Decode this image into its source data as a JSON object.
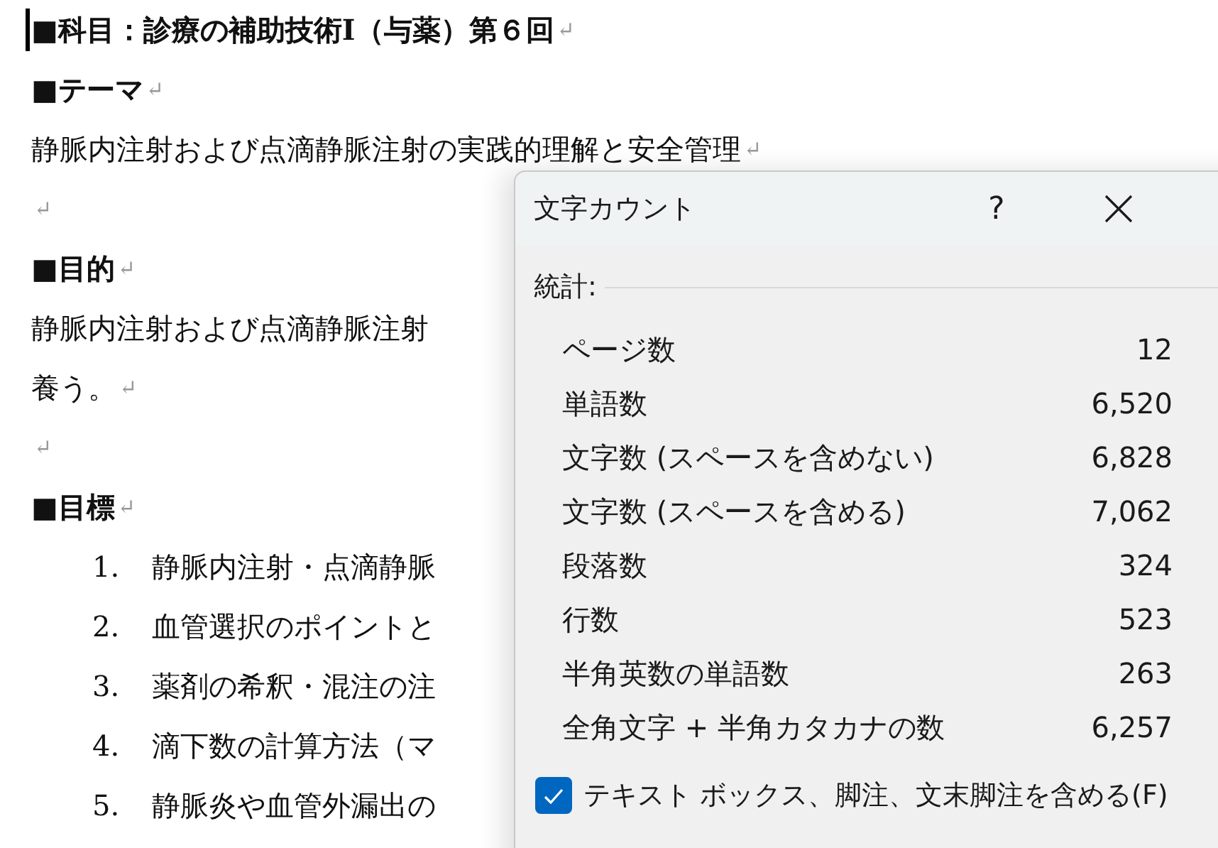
{
  "document": {
    "paragraphs": [
      {
        "kind": "heading",
        "text": "■科目：診療の補助技術Ⅰ（与薬）第６回",
        "mark": "↵",
        "cursor": true
      },
      {
        "kind": "heading",
        "text": "■テーマ",
        "mark": "↵"
      },
      {
        "kind": "body",
        "text": "静脈内注射および点滴静脈注射の実践的理解と安全管理",
        "mark": "↵"
      },
      {
        "kind": "empty",
        "mark": "↵"
      },
      {
        "kind": "heading",
        "text": "■目的",
        "mark": "↵"
      },
      {
        "kind": "body",
        "text": "静脈内注射および点滴静脈注射"
      },
      {
        "kind": "body",
        "text": "養う。",
        "mark": "↵"
      },
      {
        "kind": "empty",
        "mark": "↵"
      },
      {
        "kind": "heading",
        "text": "■目標",
        "mark": "↵"
      },
      {
        "kind": "list",
        "number": "1.",
        "text": "静脈内注射・点滴静脈"
      },
      {
        "kind": "list",
        "number": "2.",
        "text": "血管選択のポイントと"
      },
      {
        "kind": "list",
        "number": "3.",
        "text": "薬剤の希釈・混注の注"
      },
      {
        "kind": "list",
        "number": "4.",
        "text": "滴下数の計算方法（マ"
      },
      {
        "kind": "list",
        "number": "5.",
        "text": "静脈炎や血管外漏出の"
      }
    ]
  },
  "dialog": {
    "title": "文字カウント",
    "help": "?",
    "section": "統計:",
    "stats": [
      {
        "label": "ページ数",
        "value": "12"
      },
      {
        "label": "単語数",
        "value": "6,520"
      },
      {
        "label": "文字数 (スペースを含めない)",
        "value": "6,828"
      },
      {
        "label": "文字数 (スペースを含める)",
        "value": "7,062"
      },
      {
        "label": "段落数",
        "value": "324"
      },
      {
        "label": "行数",
        "value": "523"
      },
      {
        "label": "半角英数の単語数",
        "value": "263"
      },
      {
        "label": "全角文字 + 半角カタカナの数",
        "value": "6,257"
      }
    ],
    "option": {
      "label": "テキスト ボックス、脚注、文末脚注を含める(F)",
      "checked": true
    }
  }
}
